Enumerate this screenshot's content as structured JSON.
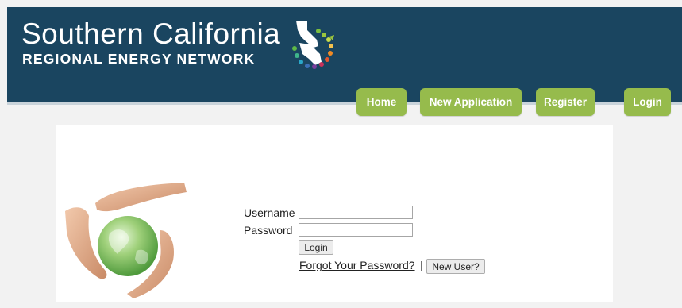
{
  "branding": {
    "line1": "Southern California",
    "line2": "REGIONAL ENERGY NETWORK"
  },
  "nav": {
    "home": "Home",
    "new_application": "New Application",
    "register": "Register",
    "login": "Login"
  },
  "login_form": {
    "username_label": "Username",
    "password_label": "Password",
    "username_value": "",
    "password_value": "",
    "login_button": "Login",
    "forgot_link": "Forgot Your Password?",
    "separator": "|",
    "new_user_button": "New User?"
  },
  "colors": {
    "header_bg": "#1a4560",
    "nav_button": "#96bb4c",
    "page_bg": "#f2f2f2"
  },
  "icons": {
    "logo_mark": "california-state-energy-icon",
    "photo": "hands-around-globe-image"
  }
}
